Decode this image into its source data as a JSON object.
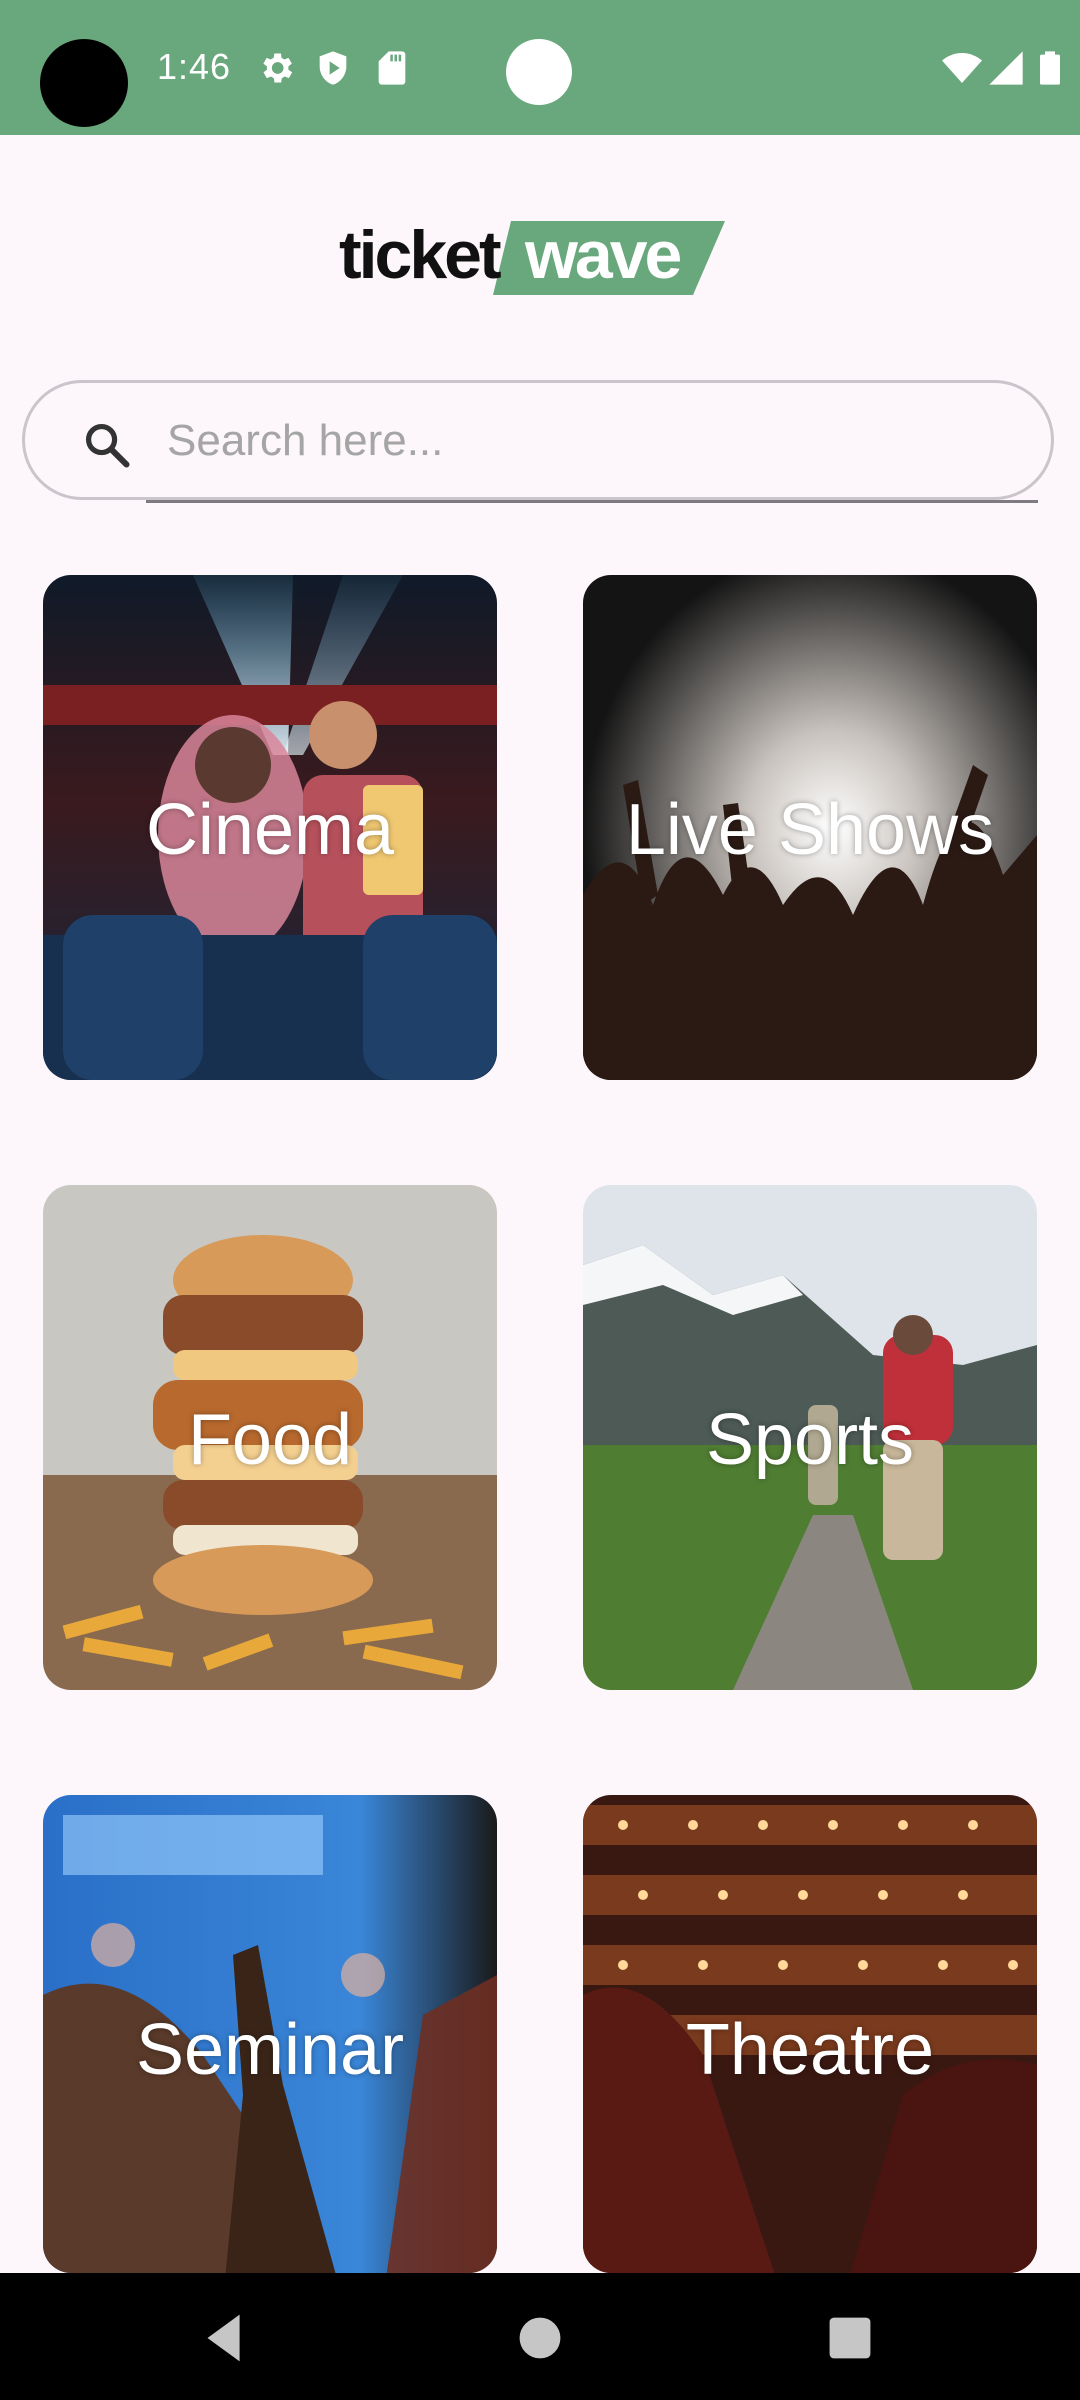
{
  "status_bar": {
    "time": "1:46",
    "icons": [
      "settings-icon",
      "shield-icon",
      "sd-card-icon",
      "wifi-icon",
      "signal-icon",
      "battery-icon"
    ]
  },
  "logo": {
    "part1": "ticket",
    "part2": "wave"
  },
  "search": {
    "placeholder": "Search here...",
    "value": ""
  },
  "categories": [
    {
      "label": "Cinema"
    },
    {
      "label": "Live Shows"
    },
    {
      "label": "Food"
    },
    {
      "label": "Sports"
    },
    {
      "label": "Seminar"
    },
    {
      "label": "Theatre"
    }
  ],
  "navigation": {
    "buttons": [
      "back-button",
      "home-button",
      "recents-button"
    ]
  },
  "colors": {
    "brand_green": "#69a77c",
    "background": "#fdf7fb",
    "text_on_image": "#ffffff"
  }
}
